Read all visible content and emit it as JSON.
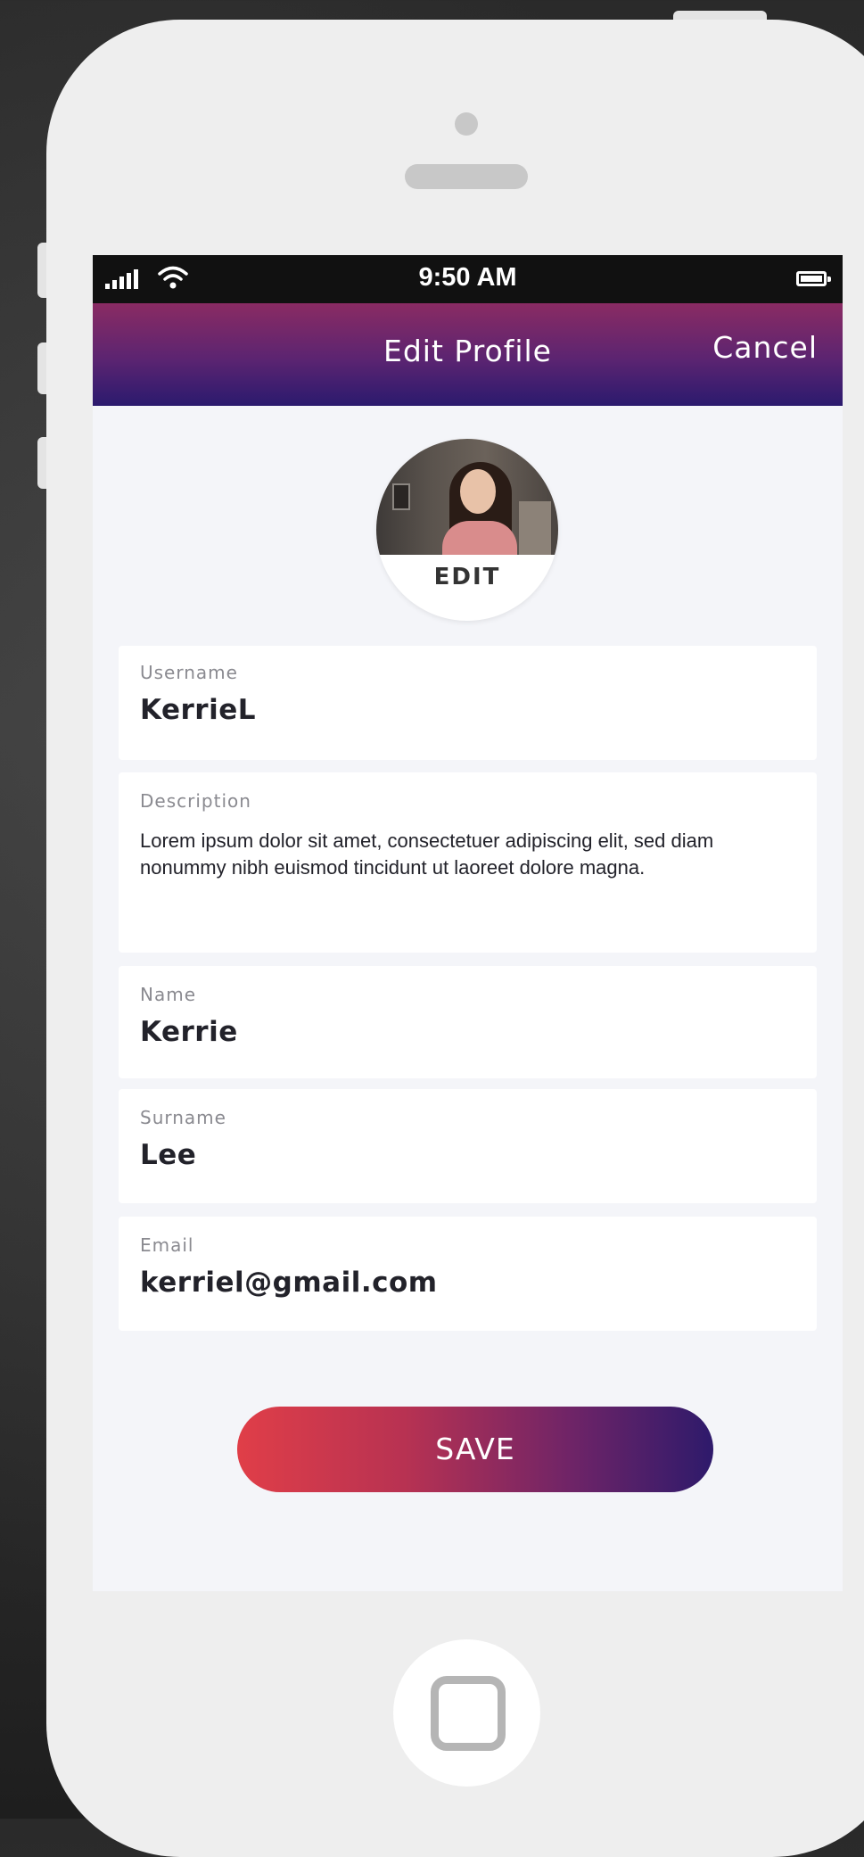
{
  "status_bar": {
    "time": "9:50 AM",
    "signal_icon": "signal-bars-icon",
    "wifi_icon": "wifi-icon",
    "battery_icon": "battery-icon"
  },
  "header": {
    "title": "Edit Profile",
    "cancel_label": "Cancel",
    "gradient": [
      "#8a2b63",
      "#2b1a6e"
    ]
  },
  "avatar": {
    "edit_label": "EDIT"
  },
  "fields": {
    "username": {
      "label": "Username",
      "value": "KerrieL"
    },
    "description": {
      "label": "Description",
      "value": "Lorem ipsum dolor sit amet, consectetuer adipiscing elit, sed diam nonummy nibh euismod tincidunt ut laoreet dolore magna."
    },
    "name": {
      "label": "Name",
      "value": "Kerrie"
    },
    "surname": {
      "label": "Surname",
      "value": "Lee"
    },
    "email": {
      "label": "Email",
      "value": "kerriel@gmail.com"
    }
  },
  "save_button": {
    "label": "SAVE",
    "gradient": [
      "#e03e48",
      "#2e1a6b"
    ]
  }
}
